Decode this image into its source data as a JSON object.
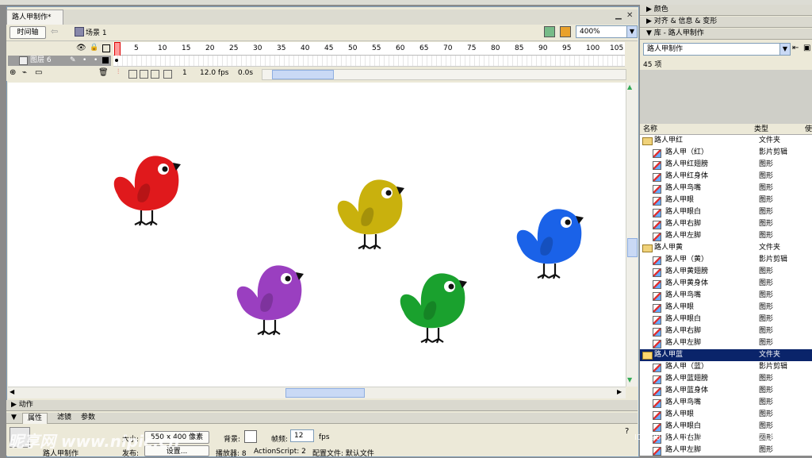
{
  "document": {
    "tab_title": "路人甲制作*",
    "timeline_button": "时间轴",
    "scene": "场景 1",
    "zoom": "400%"
  },
  "timeline": {
    "ruler_numbers": [
      "1",
      "5",
      "10",
      "15",
      "20",
      "25",
      "30",
      "35",
      "40",
      "45",
      "50",
      "55",
      "60",
      "65",
      "70",
      "75",
      "80",
      "85",
      "90",
      "95",
      "100",
      "105"
    ],
    "layer_name": "图层 6",
    "current_frame": "1",
    "frame_rate": "12.0 fps",
    "elapsed": "0.0s"
  },
  "birds": [
    {
      "name": "red",
      "color": "#e0191c"
    },
    {
      "name": "yellow",
      "color": "#c9b10d"
    },
    {
      "name": "blue",
      "color": "#1a62e8"
    },
    {
      "name": "purple",
      "color": "#9a3fc0"
    },
    {
      "name": "green",
      "color": "#1aa12e"
    }
  ],
  "panels": {
    "actions": "动作",
    "properties_tab": "属性",
    "filters_tab": "滤镜",
    "params_tab": "参数",
    "doc_name": "路人甲制作",
    "size_label": "大小:",
    "size_value": "550 x 400 像素",
    "bg_label": "背景:",
    "fps_label": "帧频:",
    "fps_value": "12",
    "fps_unit": "fps",
    "publish_label": "发布:",
    "settings_button": "设置...",
    "player_label": "播放器: 8",
    "as_label": "ActionScript: 2",
    "profile_label": "配置文件: 默认文件"
  },
  "right_panel": {
    "color": "颜色",
    "align": "对齐 & 信息 & 变形",
    "library": "库 - 路人甲制作",
    "library_dropdown": "路人甲制作",
    "item_count": "45 项",
    "col_name": "名称",
    "col_type": "类型",
    "col_use": "使",
    "items": [
      {
        "name": "路人甲红",
        "type": "文件夹",
        "folder": true
      },
      {
        "name": "路人甲（红）",
        "type": "影片剪辑"
      },
      {
        "name": "路人甲红翅膀",
        "type": "图形"
      },
      {
        "name": "路人甲红身体",
        "type": "图形"
      },
      {
        "name": "路人甲鸟嘴",
        "type": "图形"
      },
      {
        "name": "路人甲眼",
        "type": "图形"
      },
      {
        "name": "路人甲眼白",
        "type": "图形"
      },
      {
        "name": "路人甲右脚",
        "type": "图形"
      },
      {
        "name": "路人甲左脚",
        "type": "图形"
      },
      {
        "name": "路人甲黄",
        "type": "文件夹",
        "folder": true
      },
      {
        "name": "路人甲（黄）",
        "type": "影片剪辑"
      },
      {
        "name": "路人甲黄翅膀",
        "type": "图形"
      },
      {
        "name": "路人甲黄身体",
        "type": "图形"
      },
      {
        "name": "路人甲鸟嘴",
        "type": "图形"
      },
      {
        "name": "路人甲眼",
        "type": "图形"
      },
      {
        "name": "路人甲眼白",
        "type": "图形"
      },
      {
        "name": "路人甲右脚",
        "type": "图形"
      },
      {
        "name": "路人甲左脚",
        "type": "图形"
      },
      {
        "name": "路人甲蓝",
        "type": "文件夹",
        "folder": true,
        "selected": true
      },
      {
        "name": "路人甲（蓝）",
        "type": "影片剪辑"
      },
      {
        "name": "路人甲蓝翅膀",
        "type": "图形"
      },
      {
        "name": "路人甲蓝身体",
        "type": "图形"
      },
      {
        "name": "路人甲鸟嘴",
        "type": "图形"
      },
      {
        "name": "路人甲眼",
        "type": "图形"
      },
      {
        "name": "路人甲眼白",
        "type": "图形"
      },
      {
        "name": "路人甲右脚",
        "type": "图形"
      },
      {
        "name": "路人甲左脚",
        "type": "图形"
      }
    ]
  },
  "watermark": "ID:2204171 NO:20121203090521187000"
}
